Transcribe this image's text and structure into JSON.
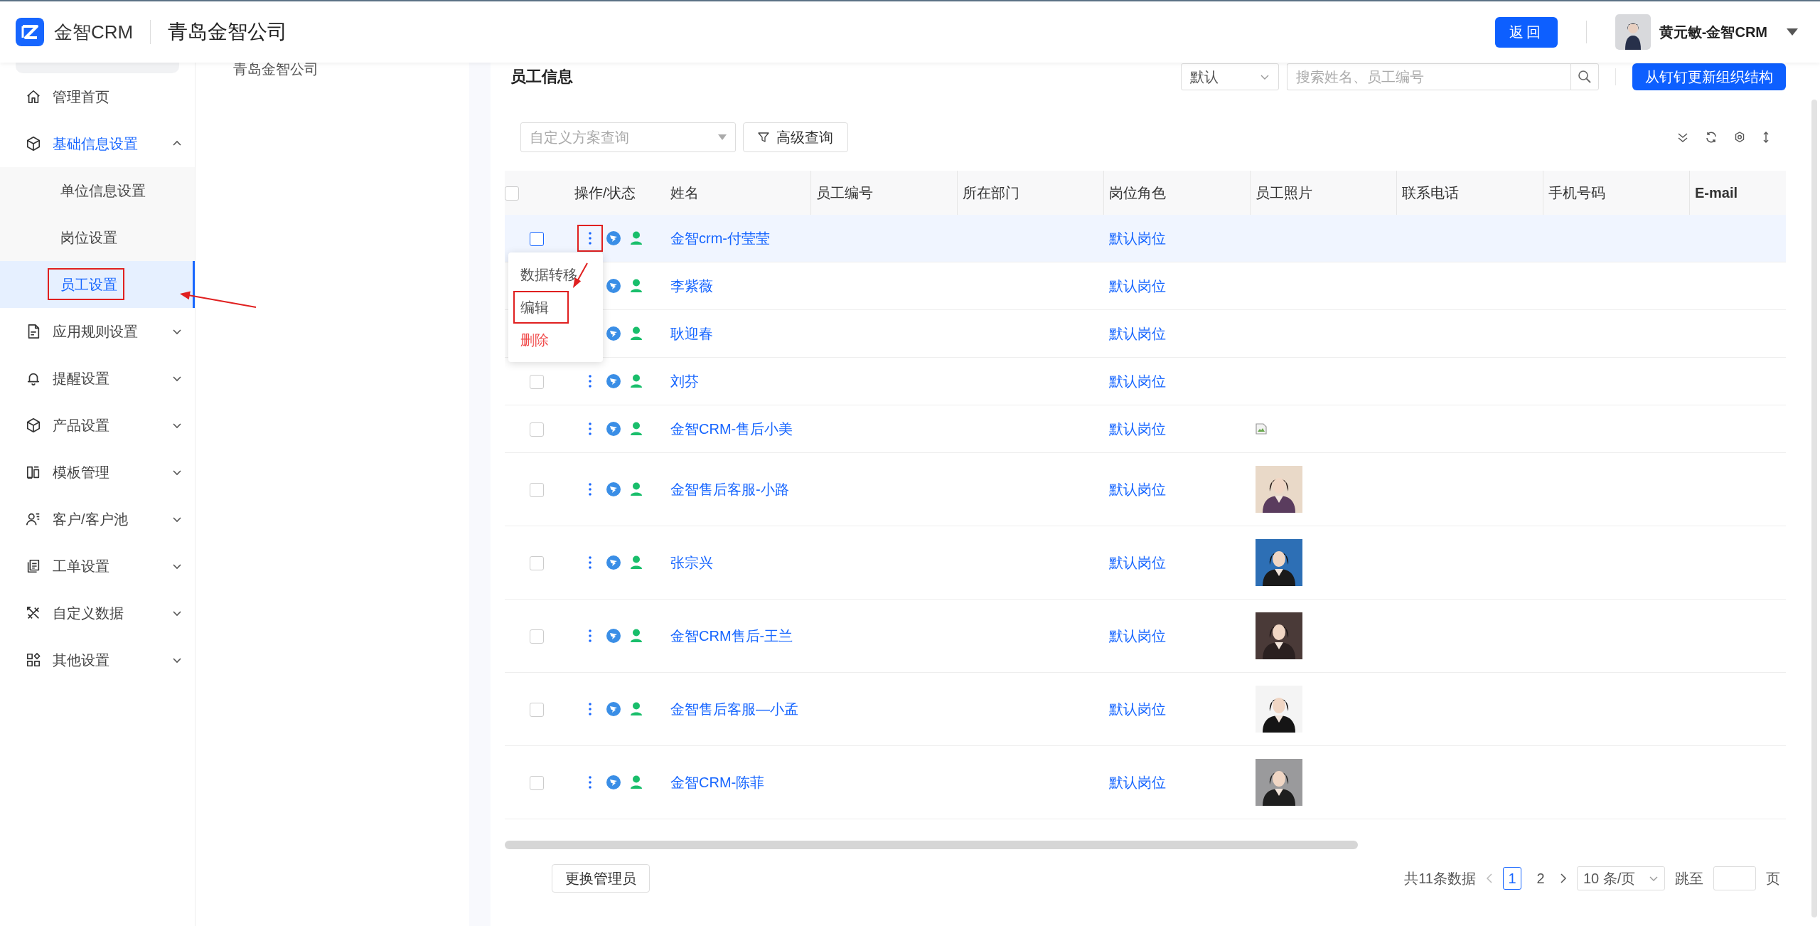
{
  "header": {
    "app_name": "金智CRM",
    "company": "青岛金智公司",
    "back_button": "返回",
    "user_name": "黄元敏-金智CRM"
  },
  "sidebar": {
    "items": [
      {
        "label": "管理首页",
        "kind": "link",
        "selected": false
      },
      {
        "label": "基础信息设置",
        "kind": "group",
        "selected": true,
        "expanded": true,
        "children": [
          {
            "label": "单位信息设置",
            "selected": false,
            "annotated": false
          },
          {
            "label": "岗位设置",
            "selected": false,
            "annotated": false
          },
          {
            "label": "员工设置",
            "selected": true,
            "annotated": true
          }
        ]
      },
      {
        "label": "应用规则设置",
        "kind": "group",
        "selected": false,
        "expanded": false
      },
      {
        "label": "提醒设置",
        "kind": "group",
        "selected": false,
        "expanded": false
      },
      {
        "label": "产品设置",
        "kind": "group",
        "selected": false,
        "expanded": false
      },
      {
        "label": "模板管理",
        "kind": "group",
        "selected": false,
        "expanded": false
      },
      {
        "label": "客户/客户池",
        "kind": "group",
        "selected": false,
        "expanded": false
      },
      {
        "label": "工单设置",
        "kind": "group",
        "selected": false,
        "expanded": false
      },
      {
        "label": "自定义数据",
        "kind": "group",
        "selected": false,
        "expanded": false
      },
      {
        "label": "其他设置",
        "kind": "group",
        "selected": false,
        "expanded": false
      }
    ]
  },
  "org_tree": {
    "root": "青岛金智公司"
  },
  "main": {
    "title": "员工信息",
    "sort_select": "默认",
    "search": {
      "placeholder": "搜索姓名、员工编号"
    },
    "sync_button": "从钉钉更新组织结构",
    "scheme_select": {
      "placeholder": "自定义方案查询"
    },
    "advanced_button": "高级查询"
  },
  "table": {
    "all_checked": false,
    "columns": [
      {
        "label": "操作/状态"
      },
      {
        "label": "姓名"
      },
      {
        "label": "员工编号"
      },
      {
        "label": "所在部门"
      },
      {
        "label": "岗位角色"
      },
      {
        "label": "员工照片"
      },
      {
        "label": "联系电话"
      },
      {
        "label": "手机号码"
      },
      {
        "label": "E-mail",
        "bold": true
      }
    ],
    "rows": [
      {
        "name": "金智crm-付莹莹",
        "role": "默认岗位",
        "checked": false,
        "selected": true,
        "annotated": true,
        "menu": {
          "items": [
            {
              "label": "数据转移",
              "kind": "normal",
              "annotated": false
            },
            {
              "label": "编辑",
              "kind": "normal",
              "annotated": true
            },
            {
              "label": "删除",
              "kind": "danger",
              "annotated": false
            }
          ]
        }
      },
      {
        "name": "李紫薇",
        "role": "默认岗位",
        "selected": false
      },
      {
        "name": "耿迎春",
        "role": "默认岗位",
        "selected": false
      },
      {
        "name": "刘芬",
        "role": "默认岗位",
        "checked": false,
        "selected": false
      },
      {
        "name": "金智CRM-售后小美",
        "role": "默认岗位",
        "checked": false,
        "selected": false,
        "photo": {
          "kind": "broken"
        }
      },
      {
        "name": "金智售后客服-小路",
        "role": "默认岗位",
        "checked": false,
        "selected": false
      },
      {
        "name": "张宗兴",
        "role": "默认岗位",
        "checked": false,
        "selected": false
      },
      {
        "name": "金智CRM售后-王兰",
        "role": "默认岗位",
        "checked": false,
        "selected": false
      },
      {
        "name": "金智售后客服—小孟",
        "role": "默认岗位",
        "checked": false,
        "selected": false
      },
      {
        "name": "金智CRM-陈菲",
        "role": "默认岗位",
        "checked": false,
        "selected": false
      }
    ]
  },
  "footer": {
    "change_admin_button": "更换管理员",
    "pagination": {
      "total": "共11条数据",
      "pages": [
        {
          "label": "1",
          "selected": true
        },
        {
          "label": "2",
          "selected": false
        }
      ],
      "page_size": "10 条/页",
      "jump_label": "跳至",
      "page_unit": "页"
    }
  }
}
